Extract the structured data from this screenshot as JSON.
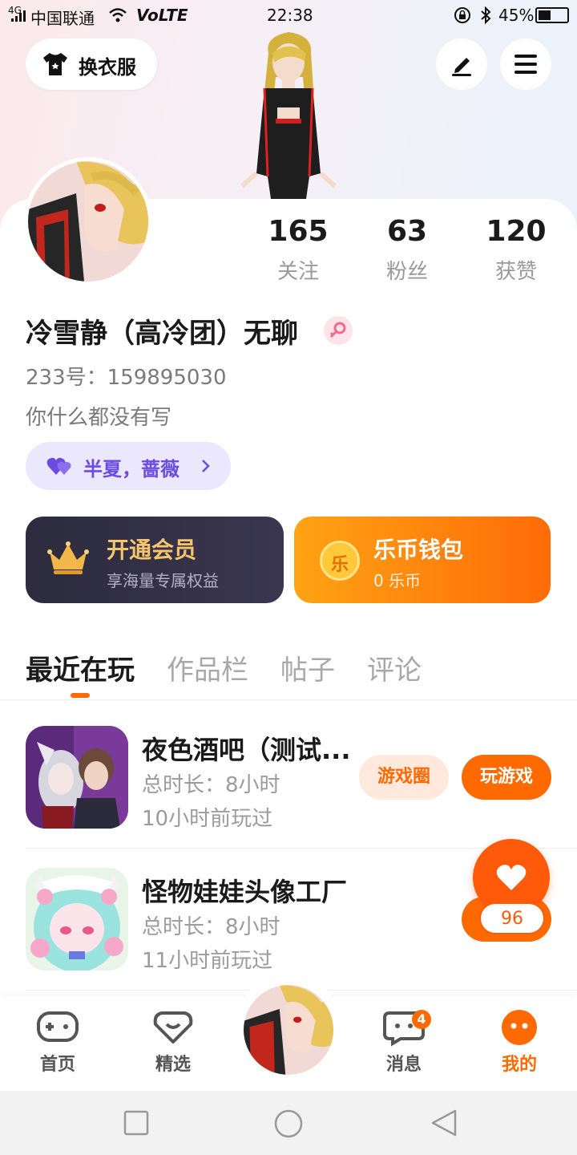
{
  "status_bar": {
    "network_type": "4G",
    "carrier": "中国联通",
    "volte": "VoLTE",
    "time": "22:38",
    "battery": "45%",
    "battery_level": 0.45
  },
  "header": {
    "outfit_button": "换衣服",
    "edit_icon": "pencil-icon",
    "menu_icon": "menu-icon"
  },
  "profile": {
    "stats": [
      {
        "value": "165",
        "label": "关注"
      },
      {
        "value": "63",
        "label": "粉丝"
      },
      {
        "value": "120",
        "label": "获赞"
      }
    ],
    "name": "冷雪静（高冷团）无聊",
    "id_line": "233号：159895030",
    "bio": "你什么都没有写",
    "cp_tag": "半夏，蔷薇"
  },
  "cards": {
    "vip": {
      "title": "开通会员",
      "subtitle": "享海量专属权益"
    },
    "wallet": {
      "title": "乐币钱包",
      "subtitle": "0 乐币",
      "coin_glyph": "乐"
    }
  },
  "tabs": [
    "最近在玩",
    "作品栏",
    "帖子",
    "评论"
  ],
  "games": [
    {
      "title": "夜色酒吧（测试...",
      "duration": "总时长：8小时",
      "last_played": "10小时前玩过",
      "circle_btn": "游戏圈",
      "play_btn": "玩游戏"
    },
    {
      "title": "怪物娃娃头像工厂",
      "duration": "总时长：8小时",
      "last_played": "11小时前玩过"
    }
  ],
  "floating_like": {
    "count": "96"
  },
  "bottom_nav": {
    "items": [
      {
        "label": "首页"
      },
      {
        "label": "精选"
      },
      {
        "label": "消息",
        "badge": "4"
      },
      {
        "label": "我的"
      }
    ]
  },
  "colors": {
    "accent": "#ff6a00",
    "vip_bg": "#2d2b3d",
    "cp_tag_text": "#6a4ce0"
  }
}
